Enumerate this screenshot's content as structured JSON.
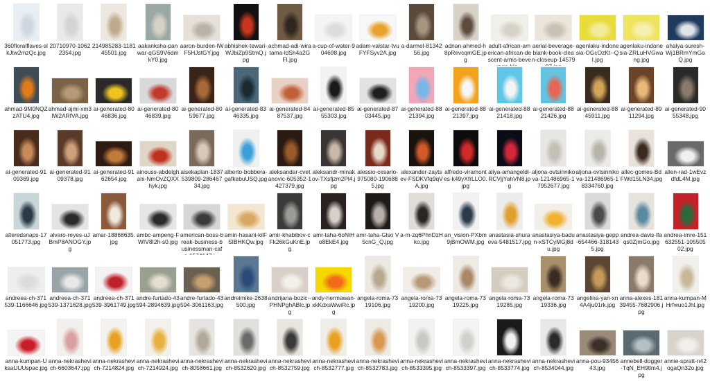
{
  "files": [
    {
      "name": "360floralflaves-slkJtw2mzQc.jpg",
      "orientation": "port",
      "thumb": {
        "bg": "#e8eef2",
        "accent": "#cfd8e0"
      }
    },
    {
      "name": "20710970-10622354.jpg",
      "orientation": "port",
      "thumb": {
        "bg": "#e9e9ea",
        "accent": "#d4d4d6"
      }
    },
    {
      "name": "214985283-118145501.jpg",
      "orientation": "port",
      "thumb": {
        "bg": "#ece7df",
        "accent": "#bfa98c"
      }
    },
    {
      "name": "aakanksha-panwar-qGS9V6dmkY0.jpg",
      "orientation": "port",
      "thumb": {
        "bg": "#9aa8a6",
        "accent": "#d8d2c4"
      }
    },
    {
      "name": "aaron-burden-lWF5HJstGY.jpg",
      "orientation": "land",
      "thumb": {
        "bg": "#e6e1d8",
        "accent": "#b8b2a8"
      }
    },
    {
      "name": "abhishek-tewari-WJbiZp9StmQ.jpg",
      "orientation": "port",
      "thumb": {
        "bg": "#111111",
        "accent": "#c8371d"
      }
    },
    {
      "name": "achmad-adi-wiratama-ldSh4a2GFI.jpg",
      "orientation": "port",
      "thumb": {
        "bg": "#6f5a44",
        "accent": "#2f261e"
      }
    },
    {
      "name": "a-cup-of-water-904698.jpg",
      "orientation": "land",
      "thumb": {
        "bg": "#f4f4f4",
        "accent": "#dcdcdc"
      }
    },
    {
      "name": "adam-valstar-tvuFYFSyv2A.jpg",
      "orientation": "land",
      "thumb": {
        "bg": "#f7f7f7",
        "accent": "#e8a12a"
      }
    },
    {
      "name": "a-darmel-8134256.jpg",
      "orientation": "port",
      "thumb": {
        "bg": "#5a4a3c",
        "accent": "#a69480"
      }
    },
    {
      "name": "adnan-ahmed-h8pRevcqmGE.jpg",
      "orientation": "port",
      "thumb": {
        "bg": "#d8d2c6",
        "accent": "#5c4c3e"
      }
    },
    {
      "name": "adult-african-american-african-descent-arms-beverage-bla...",
      "orientation": "land",
      "thumb": {
        "bg": "#f1efe9",
        "accent": "#d6d2c8"
      }
    },
    {
      "name": "aerial-beverage-blank-book-clean-closeup-1457997.jpg",
      "orientation": "land",
      "thumb": {
        "bg": "#eae6dc",
        "accent": "#c9c2b4"
      }
    },
    {
      "name": "agenlaku-indonesia-OGcOzKt--QI.jpg",
      "orientation": "land",
      "thumb": {
        "bg": "#e8dc3a",
        "accent": "#f2ec9a"
      }
    },
    {
      "name": "agenlaku-indonesia-ZRLuHVGwang.jpg",
      "orientation": "land",
      "thumb": {
        "bg": "#efe460",
        "accent": "#f6f0b0"
      }
    },
    {
      "name": "ahalya-suresh-Wj1BRmYmGaQ.jpg",
      "orientation": "land",
      "thumb": {
        "bg": "#1e3a5c",
        "accent": "#e0e4ea"
      }
    },
    {
      "name": "ahmad-9M0NQZzATU4.jpg",
      "orientation": "port",
      "thumb": {
        "bg": "#3e4c56",
        "accent": "#e27a1c"
      }
    },
    {
      "name": "ahmad-ajmi-xm3lW2ARfVA.jpg",
      "orientation": "land",
      "thumb": {
        "bg": "#7a6248",
        "accent": "#b69a78"
      }
    },
    {
      "name": "ai-generated-8046836.jpg",
      "orientation": "land",
      "thumb": {
        "bg": "#2a2a2a",
        "accent": "#f0c420"
      }
    },
    {
      "name": "ai-generated-8046839.jpg",
      "orientation": "land",
      "thumb": {
        "bg": "#d9d9d9",
        "accent": "#c0392b"
      }
    },
    {
      "name": "ai-generated-8059677.jpg",
      "orientation": "port",
      "thumb": {
        "bg": "#3a2418",
        "accent": "#a86a3a"
      }
    },
    {
      "name": "ai-generated-8346335.jpg",
      "orientation": "port",
      "thumb": {
        "bg": "#4a6878",
        "accent": "#1c2a34"
      }
    },
    {
      "name": "ai-generated-8487537.jpg",
      "orientation": "land",
      "thumb": {
        "bg": "#e8d0c4",
        "accent": "#c0603a"
      }
    },
    {
      "name": "ai-generated-8555303.jpg",
      "orientation": "port",
      "thumb": {
        "bg": "#f2f2f2",
        "accent": "#1a1a1a"
      }
    },
    {
      "name": "ai-generated-8703445.jpg",
      "orientation": "land",
      "thumb": {
        "bg": "#e2e2e2",
        "accent": "#1e1e1e"
      }
    },
    {
      "name": "ai-generated-8821394.jpg",
      "orientation": "port",
      "thumb": {
        "bg": "#f2a7b6",
        "accent": "#79b6e8"
      }
    },
    {
      "name": "ai-generated-8821397.jpg",
      "orientation": "port",
      "thumb": {
        "bg": "#f4a11c",
        "accent": "#f6f6f6"
      }
    },
    {
      "name": "ai-generated-8821418.jpg",
      "orientation": "port",
      "thumb": {
        "bg": "#5ec6e6",
        "accent": "#f4f4f4"
      }
    },
    {
      "name": "ai-generated-8821426.jpg",
      "orientation": "port",
      "thumb": {
        "bg": "#62c4e0",
        "accent": "#e86454"
      }
    },
    {
      "name": "ai-generated-8845911.jpg",
      "orientation": "port",
      "thumb": {
        "bg": "#3a2c1c",
        "accent": "#d2a45a"
      }
    },
    {
      "name": "ai-generated-8911294.jpg",
      "orientation": "port",
      "thumb": {
        "bg": "#6a4428",
        "accent": "#e8b878"
      }
    },
    {
      "name": "ai-generated-9055348.jpg",
      "orientation": "port",
      "thumb": {
        "bg": "#2c2a28",
        "accent": "#8a7a6a"
      }
    },
    {
      "name": "ai-generated-9109369.jpg",
      "orientation": "port",
      "thumb": {
        "bg": "#4a2c1c",
        "accent": "#c88a5a"
      }
    },
    {
      "name": "ai-generated-9109378.jpg",
      "orientation": "port",
      "thumb": {
        "bg": "#5a3a28",
        "accent": "#d0a078"
      }
    },
    {
      "name": "ai-generated-9162654.jpg",
      "orientation": "land",
      "thumb": {
        "bg": "#2e1c12",
        "accent": "#c27a3a"
      }
    },
    {
      "name": "ainouss-abdelghani-NmOvZQXXhyk.jpg",
      "orientation": "land",
      "thumb": {
        "bg": "#e0d6c8",
        "accent": "#c0301e"
      }
    },
    {
      "name": "aisekaplan-1837539809-28646734.jpg",
      "orientation": "port",
      "thumb": {
        "bg": "#7a6a5a",
        "accent": "#d8cab8"
      }
    },
    {
      "name": "alberto-bobbera-gafkebuUSQ.jpg",
      "orientation": "port",
      "thumb": {
        "bg": "#f0f0f0",
        "accent": "#3aa0d8"
      }
    },
    {
      "name": "aleksandar-cvetanovic-605352-1427379.jpg",
      "orientation": "port",
      "thumb": {
        "bg": "#2a1a12",
        "accent": "#9a5a2a"
      }
    },
    {
      "name": "aleksandr-minakov-TXsfjzm2Pl4.jpg",
      "orientation": "port",
      "thumb": {
        "bg": "#3a3432",
        "accent": "#c8b8a8"
      }
    },
    {
      "name": "alessio-cesario-975080-1906885.jpg",
      "orientation": "port",
      "thumb": {
        "bg": "#7a2a1c",
        "accent": "#e8d8c8"
      }
    },
    {
      "name": "alexander-zaytsev-FSDKVfq9qVA.jpg",
      "orientation": "port",
      "thumb": {
        "bg": "#1a120c",
        "accent": "#d05a2a"
      }
    },
    {
      "name": "alfredo-viramontes-k49yXfrLLO0.jpg",
      "orientation": "port",
      "thumb": {
        "bg": "#0c0c0c",
        "accent": "#d02a2a"
      }
    },
    {
      "name": "aliya-amangeldi-RCVjjYahVN8.jpg",
      "orientation": "port",
      "thumb": {
        "bg": "#0a0c18",
        "accent": "#d0283a"
      }
    },
    {
      "name": "aljona-ovtsinnikova-121486965-17952677.jpg",
      "orientation": "port",
      "thumb": {
        "bg": "#e8e6e2",
        "accent": "#c4c0b8"
      }
    },
    {
      "name": "aljona-ovtsinnikova-121486965-18334760.jpg",
      "orientation": "port",
      "thumb": {
        "bg": "#ecebe8",
        "accent": "#b8b4ac"
      }
    },
    {
      "name": "allec-gomes-BdFWd15LN34.jpg",
      "orientation": "port",
      "thumb": {
        "bg": "#e8e2da",
        "accent": "#3a2a20"
      }
    },
    {
      "name": "allen-rad-1wEvzdfdL4M.jpg",
      "orientation": "land",
      "thumb": {
        "bg": "#6a6a6a",
        "accent": "#f0f0f0"
      }
    },
    {
      "name": "alteredsnaps-17051773.jpg",
      "orientation": "port",
      "thumb": {
        "bg": "#c8d6da",
        "accent": "#2a3a44"
      }
    },
    {
      "name": "alvaro-reyes-uJBmP8ANOGY.jpg",
      "orientation": "land",
      "thumb": {
        "bg": "#e4e4e4",
        "accent": "#2a2a2a"
      }
    },
    {
      "name": "amar-18868635.jpg",
      "orientation": "port",
      "thumb": {
        "bg": "#8a5a3a",
        "accent": "#f0e8dc"
      }
    },
    {
      "name": "ambc-ampeng-FWIV8I2h-s0.jpg",
      "orientation": "land",
      "thumb": {
        "bg": "#e6e6e6",
        "accent": "#2a2a2a"
      }
    },
    {
      "name": "american-boss-break-business-businessman-cafe-1574147.j...",
      "orientation": "land",
      "thumb": {
        "bg": "#d8d6d4",
        "accent": "#3a3a3a"
      }
    },
    {
      "name": "amin-hasani-kilFSIBHKQw.jpg",
      "orientation": "land",
      "thumb": {
        "bg": "#f2e6d0",
        "accent": "#d8a860"
      }
    },
    {
      "name": "amir-khabibov-cFk26kGuKnE.jpg",
      "orientation": "port",
      "thumb": {
        "bg": "#3a3a38",
        "accent": "#9a9a96"
      }
    },
    {
      "name": "amr-taha-6oNiHo8EkE4.jpg",
      "orientation": "port",
      "thumb": {
        "bg": "#2a2220",
        "accent": "#d8d0c8"
      }
    },
    {
      "name": "amr-taha-Glso V5cnG_Q.jpg",
      "orientation": "port",
      "thumb": {
        "bg": "#1e1a18",
        "accent": "#b8b0a8"
      }
    },
    {
      "name": "a-m-zq6PhnDzHko.jpg",
      "orientation": "port",
      "thumb": {
        "bg": "#e0dcd8",
        "accent": "#2a2626"
      }
    },
    {
      "name": "an_vision-PXbm9jBmOWM.jpg",
      "orientation": "port",
      "thumb": {
        "bg": "#f2f2f2",
        "accent": "#2a3a4a"
      }
    },
    {
      "name": "anastasia-shuraeva-5481517.jpg",
      "orientation": "port",
      "thumb": {
        "bg": "#ececea",
        "accent": "#e0a030"
      }
    },
    {
      "name": "anastasiya-badun-xSTCyMGj8du.jpg",
      "orientation": "land",
      "thumb": {
        "bg": "#f2efe8",
        "accent": "#f0b030"
      }
    },
    {
      "name": "anastasiya-gepp-654466-3181435.jpg",
      "orientation": "port",
      "thumb": {
        "bg": "#dadad8",
        "accent": "#4a4a4a"
      }
    },
    {
      "name": "andrea-davis-lfaqs0ZjmGo.jpg",
      "orientation": "port",
      "thumb": {
        "bg": "#e6e2dc",
        "accent": "#5a8aa0"
      }
    },
    {
      "name": "andrea-imre-151632551-10550502.jpg",
      "orientation": "port",
      "thumb": {
        "bg": "#c8202a",
        "accent": "#2a6a3a"
      }
    },
    {
      "name": "andreea-ch-371539-1166646.jpg",
      "orientation": "land",
      "thumb": {
        "bg": "#eeeeee",
        "accent": "#dcdcdc"
      }
    },
    {
      "name": "andreea-ch-371539-1371628.jpg",
      "orientation": "land",
      "thumb": {
        "bg": "#9aa4a8",
        "accent": "#e8e8e8"
      }
    },
    {
      "name": "andreea-ch-371539-3961749.jpg",
      "orientation": "land",
      "thumb": {
        "bg": "#f2f2f2",
        "accent": "#c0202a"
      }
    },
    {
      "name": "andre-furtado-43594-2894639.jpg",
      "orientation": "land",
      "thumb": {
        "bg": "#9aa090",
        "accent": "#e4ddd0"
      }
    },
    {
      "name": "andre-furtado-43594-3061163.jpg",
      "orientation": "land",
      "thumb": {
        "bg": "#6a6050",
        "accent": "#c8a070"
      }
    },
    {
      "name": "andreimike-2638500.jpg",
      "orientation": "port",
      "thumb": {
        "bg": "#5a7890",
        "accent": "#2a4a7a"
      }
    },
    {
      "name": "andrijana-bozic--PHNPghABlc.jpg",
      "orientation": "land",
      "thumb": {
        "bg": "#d8d0c8",
        "accent": "#f4f0ea"
      }
    },
    {
      "name": "andy-hermawan-xkKdxsWwiRc.jpg",
      "orientation": "land",
      "thumb": {
        "bg": "#f4d800",
        "accent": "#f26a1a"
      }
    },
    {
      "name": "angela-roma-7319106.jpg",
      "orientation": "port",
      "thumb": {
        "bg": "#ece8e2",
        "accent": "#b8a890"
      }
    },
    {
      "name": "angela-roma-7319200.jpg",
      "orientation": "land",
      "thumb": {
        "bg": "#f0ede8",
        "accent": "#b89878"
      }
    },
    {
      "name": "angela-roma-7319225.jpg",
      "orientation": "port",
      "thumb": {
        "bg": "#efebe4",
        "accent": "#a88868"
      }
    },
    {
      "name": "angela-roma-7319285.jpg",
      "orientation": "land",
      "thumb": {
        "bg": "#d4ccc0",
        "accent": "#ece8e0"
      }
    },
    {
      "name": "angela-roma-7319336.jpg",
      "orientation": "port",
      "thumb": {
        "bg": "#a8906c",
        "accent": "#3a2c20"
      }
    },
    {
      "name": "angelina-yan-xn4A4ju01rk.jpg",
      "orientation": "port",
      "thumb": {
        "bg": "#5a4632",
        "accent": "#c89a5a"
      }
    },
    {
      "name": "anna-alexes-18139455-7682906.jpg",
      "orientation": "port",
      "thumb": {
        "bg": "#8a7a6a",
        "accent": "#e8dccc"
      }
    },
    {
      "name": "anna-kumpan-MHrfwuo1Jhl.jpg",
      "orientation": "port",
      "thumb": {
        "bg": "#f2f0ec",
        "accent": "#c8b898"
      }
    },
    {
      "name": "anna-kumpan-UksaUUUspac.jpg",
      "orientation": "land",
      "thumb": {
        "bg": "#f4f4f4",
        "accent": "#c81e2a"
      }
    },
    {
      "name": "anna-nekrashevich-6603647.jpg",
      "orientation": "port",
      "thumb": {
        "bg": "#f2f0ec",
        "accent": "#d8a0a0"
      }
    },
    {
      "name": "anna-nekrashevich-7214824.jpg",
      "orientation": "port",
      "thumb": {
        "bg": "#f4f2ee",
        "accent": "#e8a020"
      }
    },
    {
      "name": "anna-nekrashevich-7214924.jpg",
      "orientation": "port",
      "thumb": {
        "bg": "#f3f1ec",
        "accent": "#e8b040"
      }
    },
    {
      "name": "anna-nekrashevich-8058661.jpg",
      "orientation": "port",
      "thumb": {
        "bg": "#e6e4e0",
        "accent": "#b0a898"
      }
    },
    {
      "name": "anna-nekrashevich-8532620.jpg",
      "orientation": "port",
      "thumb": {
        "bg": "#e2e0dc",
        "accent": "#6a6a6a"
      }
    },
    {
      "name": "anna-nekrashevich-8532759.jpg",
      "orientation": "port",
      "thumb": {
        "bg": "#e8e4de",
        "accent": "#3a3a3a"
      }
    },
    {
      "name": "anna-nekrashevich-8532777.jpg",
      "orientation": "port",
      "thumb": {
        "bg": "#f0ece6",
        "accent": "#e8a020"
      }
    },
    {
      "name": "anna-nekrashevich-8532783.jpg",
      "orientation": "port",
      "thumb": {
        "bg": "#eeeae4",
        "accent": "#d89850"
      }
    },
    {
      "name": "anna-nekrashevich-8533395.jpg",
      "orientation": "port",
      "thumb": {
        "bg": "#f2f2f0",
        "accent": "#c8c8c4"
      }
    },
    {
      "name": "anna-nekrashevich-8533397.jpg",
      "orientation": "port",
      "thumb": {
        "bg": "#f4f4f2",
        "accent": "#d0d0cc"
      }
    },
    {
      "name": "anna-nekrashevich-8533774.jpg",
      "orientation": "port",
      "thumb": {
        "bg": "#1a1a1a",
        "accent": "#f0f0f0"
      }
    },
    {
      "name": "anna-nekrashevich-8534044.jpg",
      "orientation": "port",
      "thumb": {
        "bg": "#e8e8e6",
        "accent": "#2a2a2a"
      }
    },
    {
      "name": "anna-pou-9345643.jpg",
      "orientation": "land",
      "thumb": {
        "bg": "#9a8a7a",
        "accent": "#3a3028"
      }
    },
    {
      "name": "annebell-dogger-TqN_EH9tlm4.jpg",
      "orientation": "land",
      "thumb": {
        "bg": "#5a6a70",
        "accent": "#b4c0c4"
      }
    },
    {
      "name": "annie-spratt-n42ogaQn32o.jpg",
      "orientation": "land",
      "thumb": {
        "bg": "#d8d4cc",
        "accent": "#f2f0ec"
      }
    }
  ]
}
